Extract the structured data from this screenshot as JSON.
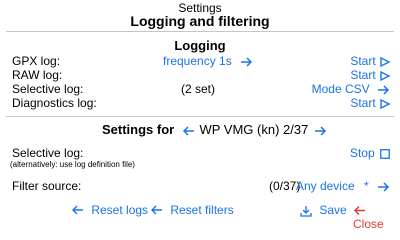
{
  "header": {
    "window_title": "Settings",
    "page_title": "Logging and filtering"
  },
  "logging": {
    "section_title": "Logging",
    "gpx": {
      "label": "GPX log:",
      "value": "frequency 1s",
      "action": "Start"
    },
    "raw": {
      "label": "RAW log:",
      "action": "Start"
    },
    "selective": {
      "label": "Selective log:",
      "value": "(2 set)",
      "action": "Mode CSV"
    },
    "diagnostics": {
      "label": "Diagnostics log:",
      "action": "Start"
    }
  },
  "settings_for": {
    "prefix": "Settings for",
    "selected": "WP VMG (kn) 2/37",
    "selective_label": "Selective log:",
    "note": "(alternatively: use log definition file)",
    "stop_label": "Stop"
  },
  "filter": {
    "label": "Filter source:",
    "count": "(0/37)",
    "value": "Any device",
    "asterisk": "*"
  },
  "footer": {
    "reset_logs": "Reset logs",
    "reset_filters": "Reset filters",
    "save": "Save",
    "close": "Close"
  },
  "colors": {
    "accent": "#1a73e8",
    "danger": "#e53935",
    "divider": "#c6c6c6"
  },
  "icons": [
    "arrow-right-icon",
    "arrow-left-icon",
    "checkbox-icon",
    "undo-arrow-icon",
    "download-icon",
    "close-arrow-icon"
  ]
}
